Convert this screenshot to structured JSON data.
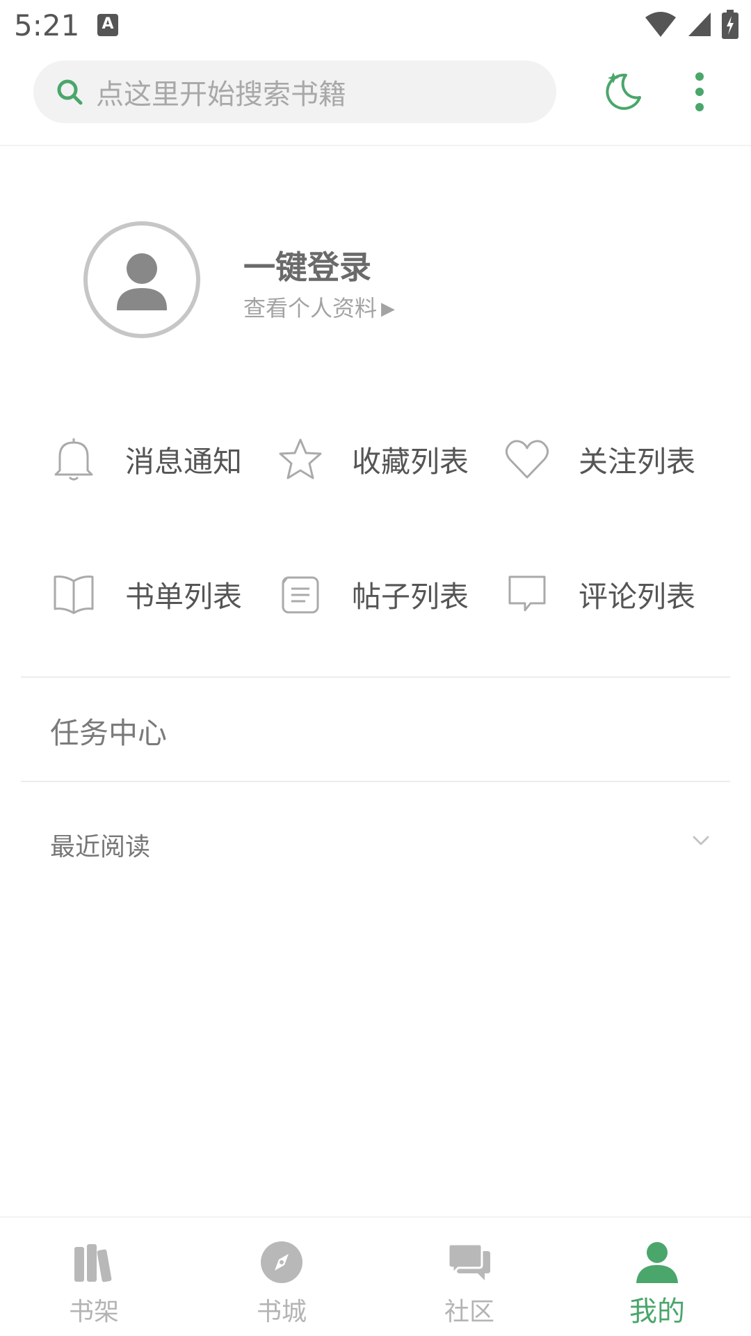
{
  "status_bar": {
    "time": "5:21",
    "notif_letter": "A"
  },
  "search": {
    "placeholder": "点这里开始搜索书籍"
  },
  "colors": {
    "accent": "#4aa66b",
    "icon_gray": "#b8b8b8",
    "text_gray": "#555555"
  },
  "profile": {
    "title": "一键登录",
    "subtitle": "查看个人资料"
  },
  "grid": [
    {
      "label": "消息通知",
      "icon": "bell-icon"
    },
    {
      "label": "收藏列表",
      "icon": "star-icon"
    },
    {
      "label": "关注列表",
      "icon": "heart-icon"
    },
    {
      "label": "书单列表",
      "icon": "book-icon"
    },
    {
      "label": "帖子列表",
      "icon": "document-icon"
    },
    {
      "label": "评论列表",
      "icon": "comment-icon"
    }
  ],
  "task_center": "任务中心",
  "recent": {
    "label": "最近阅读"
  },
  "bottom_nav": [
    {
      "label": "书架",
      "icon": "bookshelf-icon",
      "active": false
    },
    {
      "label": "书城",
      "icon": "compass-icon",
      "active": false
    },
    {
      "label": "社区",
      "icon": "chat-icon",
      "active": false
    },
    {
      "label": "我的",
      "icon": "person-icon",
      "active": true
    }
  ]
}
